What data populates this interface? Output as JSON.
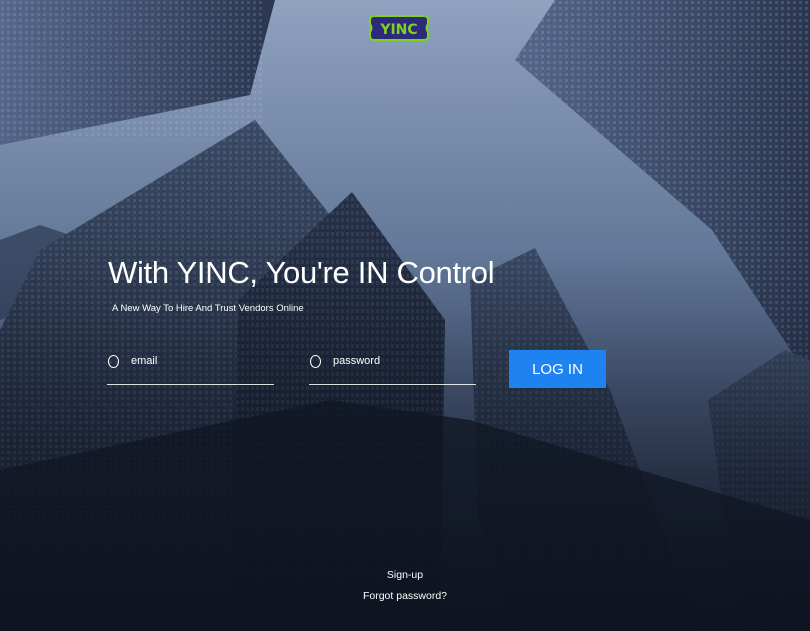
{
  "brand": {
    "logo_text": "YINC",
    "logo_color": "#7ed321",
    "logo_outline": "#2e2a7a"
  },
  "hero": {
    "title": "With YINC, You're IN Control",
    "subtitle": "A New Way To Hire And Trust Vendors Online"
  },
  "form": {
    "email_placeholder": "email",
    "password_placeholder": "password",
    "login_label": "LOG IN",
    "login_color": "#1e82f0"
  },
  "links": {
    "signup": "Sign-up",
    "forgot_password": "Forgot password?"
  },
  "icons": {
    "email_icon": "circle-outline",
    "password_icon": "circle-outline"
  }
}
